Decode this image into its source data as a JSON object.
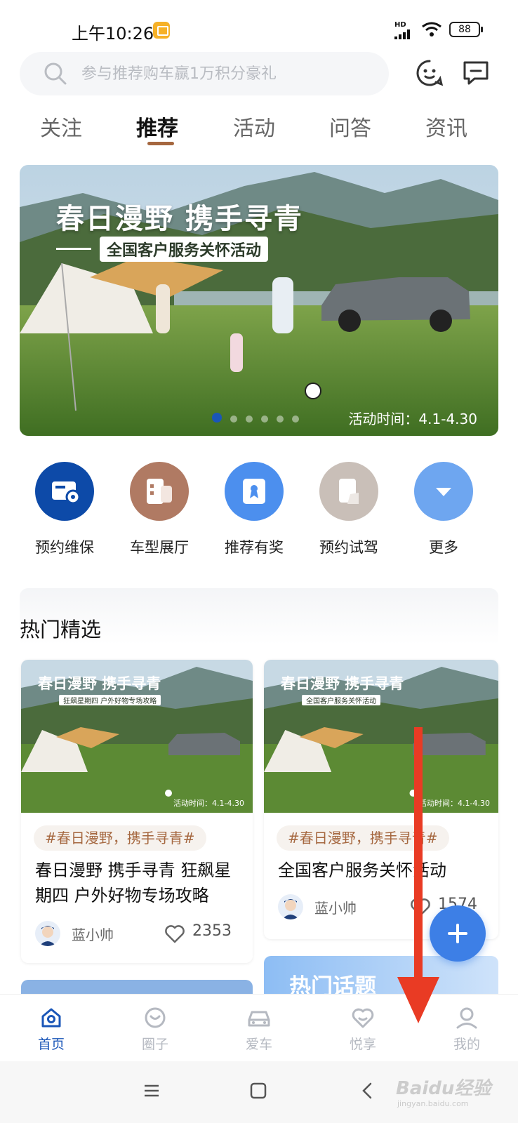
{
  "status_bar": {
    "time": "上午10:26",
    "network": "HD",
    "battery": "88"
  },
  "search": {
    "placeholder": "参与推荐购车赢1万积分豪礼"
  },
  "tabs": [
    "关注",
    "推荐",
    "活动",
    "问答",
    "资讯"
  ],
  "active_tab": "推荐",
  "banner": {
    "title": "春日漫野  携手寻青",
    "subtitle": "全国客户服务关怀活动",
    "date": "活动时间：4.1-4.30",
    "slide_count": 6,
    "active_slide": 1
  },
  "quick_menu": [
    {
      "label": "预约维保",
      "icon": "maintenance-icon",
      "color": "#0d4aa8"
    },
    {
      "label": "车型展厅",
      "icon": "showroom-icon",
      "color": "#b07a63"
    },
    {
      "label": "推荐有奖",
      "icon": "referral-icon",
      "color": "#4c8fee"
    },
    {
      "label": "预约试驾",
      "icon": "test-drive-icon",
      "color": "#c9bfb8"
    },
    {
      "label": "更多",
      "icon": "more-icon",
      "color": "#6ea6f0"
    }
  ],
  "hot_section": {
    "title": "热门精选",
    "cards": [
      {
        "thumb_title": "春日漫野  携手寻青",
        "thumb_subtitle": "狂飙星期四 户外好物专场攻略",
        "thumb_date": "活动时间：4.1-4.30",
        "tag": "#春日漫野，携手寻青#",
        "text": "春日漫野 携手寻青  狂飙星期四 户外好物专场攻略",
        "author": "蓝小帅",
        "likes": "2353"
      },
      {
        "thumb_title": "春日漫野  携手寻青",
        "thumb_subtitle": "全国客户服务关怀活动",
        "thumb_date": "活动时间：4.1-4.30",
        "tag": "#春日漫野，携手寻青#",
        "text": "全国客户服务关怀活动",
        "author": "蓝小帅",
        "likes": "1574"
      }
    ],
    "topic_label": "热门话题"
  },
  "bottom_nav": [
    {
      "label": "首页",
      "icon": "home-icon",
      "active": true
    },
    {
      "label": "圈子",
      "icon": "circle-icon",
      "active": false
    },
    {
      "label": "爱车",
      "icon": "car-icon",
      "active": false
    },
    {
      "label": "悦享",
      "icon": "heart-icon",
      "active": false
    },
    {
      "label": "我的",
      "icon": "profile-icon",
      "active": false
    }
  ],
  "watermark": {
    "text": "Baidu经验",
    "sub": "jingyan.baidu.com"
  },
  "colors": {
    "accent": "#1a56b8",
    "tab_underline": "#a5673f",
    "tag_text": "#a5673f",
    "arrow": "#e93b24"
  }
}
